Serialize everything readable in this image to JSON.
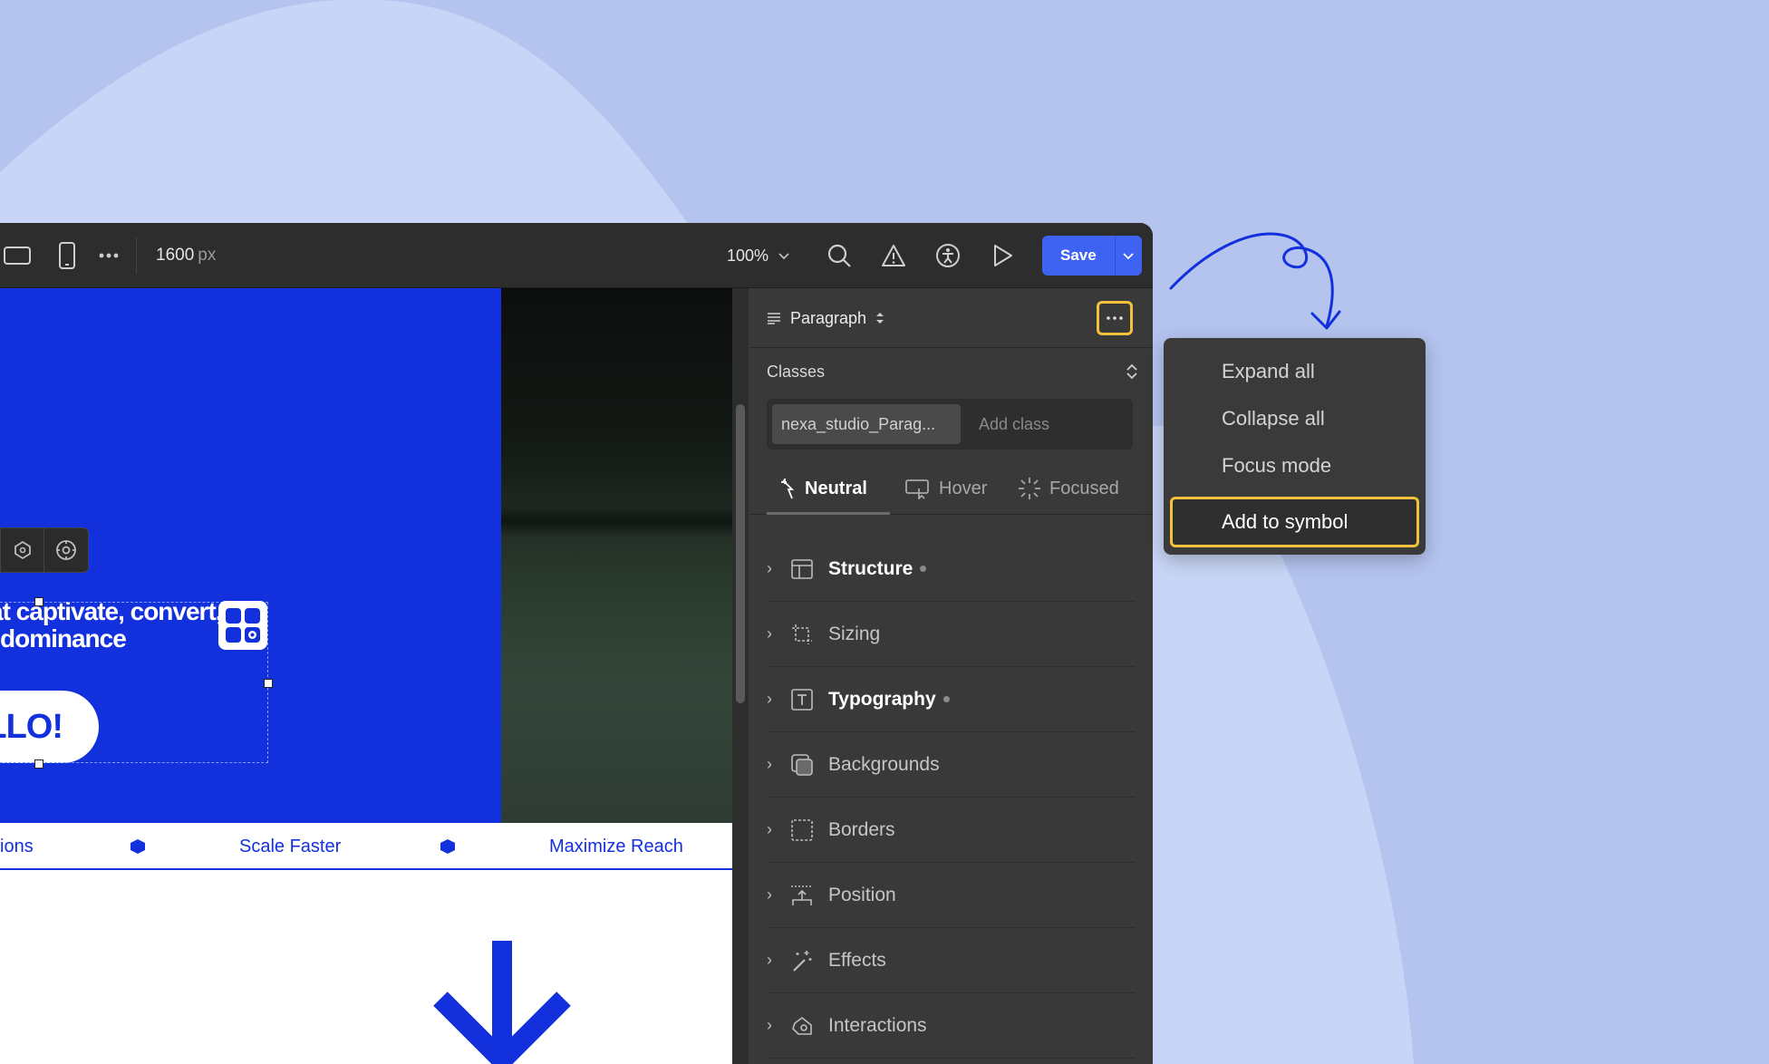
{
  "toolbar": {
    "width_value": "1600",
    "width_unit": "px",
    "zoom": "100%",
    "save_label": "Save",
    "icons": [
      "tablet-landscape-icon",
      "mobile-icon",
      "more-icon",
      "search-icon",
      "warning-icon",
      "accessibility-icon",
      "play-icon",
      "chevron-down-icon"
    ]
  },
  "canvas": {
    "hero_line1": "at captivate, convert,",
    "hero_line2": "dominance",
    "cta_label": "LLO!",
    "marquee": [
      "ions",
      "Scale Faster",
      "Maximize Reach"
    ]
  },
  "panel": {
    "element_type": "Paragraph",
    "classes_label": "Classes",
    "class_chip": "nexa_studio_Parag...",
    "add_class_placeholder": "Add class",
    "states": [
      "Neutral",
      "Hover",
      "Focused"
    ],
    "sections": [
      {
        "label": "Structure",
        "active": true
      },
      {
        "label": "Sizing",
        "active": false
      },
      {
        "label": "Typography",
        "active": true
      },
      {
        "label": "Backgrounds",
        "active": false
      },
      {
        "label": "Borders",
        "active": false
      },
      {
        "label": "Position",
        "active": false
      },
      {
        "label": "Effects",
        "active": false
      },
      {
        "label": "Interactions",
        "active": false
      }
    ]
  },
  "menu": {
    "items": [
      "Expand all",
      "Collapse all",
      "Focus mode",
      "Add to symbol"
    ]
  },
  "colors": {
    "accent": "#3e63f2",
    "brand_blue": "#1230dc",
    "highlight": "#f2c23a",
    "background": "#b4c4ef"
  }
}
